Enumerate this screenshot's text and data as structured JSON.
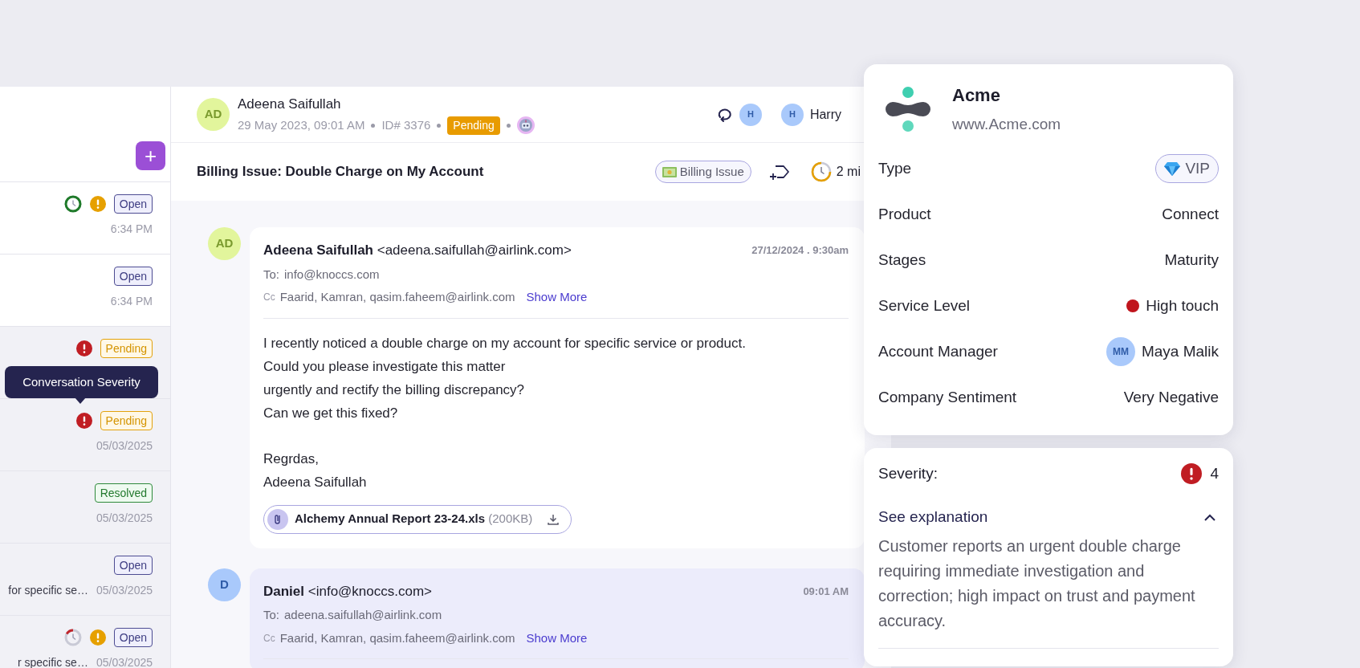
{
  "conversation_list": {
    "new_button": "+",
    "items": [
      {
        "read": false,
        "sla_overdue": false,
        "urgent": false,
        "status": "Open",
        "kind": "open",
        "time": "6:34 PM"
      },
      {
        "read": false,
        "status": "Open",
        "kind": "open",
        "time": "6:34 PM"
      },
      {
        "read": true,
        "urgent": true,
        "status": "Pending",
        "kind": "pending"
      },
      {
        "read": true,
        "urgent": true,
        "status": "Pending",
        "kind": "pending",
        "time": "05/03/2025"
      },
      {
        "read": true,
        "status": "Resolved",
        "kind": "resolved",
        "time": "05/03/2025"
      },
      {
        "read": true,
        "status": "Open",
        "kind": "open",
        "snippet": "for specific se…",
        "time": "05/03/2025"
      },
      {
        "read": true,
        "sla_overdue": true,
        "urgent": false,
        "status": "Open",
        "kind": "open",
        "snippet": "r specific se…",
        "time": "05/03/2025"
      }
    ],
    "tooltip": "Conversation Severity"
  },
  "conversation": {
    "customer": {
      "initials": "AD",
      "name": "Adeena Saifullah"
    },
    "date": "29 May 2023, 09:01 AM",
    "id": "ID# 3376",
    "status": "Pending",
    "watchers": [
      {
        "initials": "H"
      }
    ],
    "assignee": {
      "initials": "H",
      "name": "Harry"
    },
    "subject": "Billing Issue: Double Charge on My Account",
    "tag": "Billing Issue",
    "timer": "2 mi",
    "messages": [
      {
        "kind": "incoming",
        "initials": "AD",
        "sender": "Adeena Saifullah",
        "email": "<adeena.saifullah@airlink.com>",
        "time": "27/12/2024 . 9:30am",
        "to_label": "To:",
        "to": "info@knoccs.com",
        "cc_label": "Cc",
        "cc": "Faarid, Kamran, qasim.faheem@airlink.com",
        "show_more": "Show More",
        "paragraphs": [
          [
            "I recently noticed a double charge on my account for specific service or product.",
            "Could you please investigate this matter",
            "urgently and rectify the billing discrepancy?",
            "Can we get this fixed?"
          ],
          [
            "Regrdas,",
            "Adeena Saifullah"
          ]
        ],
        "attachment": {
          "name": "Alchemy Annual Report 23-24.xls",
          "size": "(200KB)"
        }
      },
      {
        "kind": "outgoing",
        "initials": "D",
        "sender": "Daniel",
        "email": "<info@knoccs.com>",
        "time": "09:01 AM",
        "to_label": "To:",
        "to": "adeena.saifullah@airlink.com",
        "cc_label": "Cc",
        "cc": "Faarid, Kamran, qasim.faheem@airlink.com",
        "show_more": "Show More"
      }
    ]
  },
  "account": {
    "name": "Acme",
    "website": "www.Acme.com",
    "fields": [
      {
        "label": "Type",
        "value": "VIP",
        "kind": "badge"
      },
      {
        "label": "Product",
        "value": "Connect",
        "kind": "text"
      },
      {
        "label": "Stages",
        "value": "Maturity",
        "kind": "text"
      },
      {
        "label": "Service Level",
        "value": "High touch",
        "kind": "dot",
        "color": "#c0141c"
      },
      {
        "label": "Account Manager",
        "value": "Maya Malik",
        "kind": "person",
        "initials": "MM"
      },
      {
        "label": "Company Sentiment",
        "value": "Very Negative",
        "kind": "text"
      }
    ]
  },
  "severity": {
    "label": "Severity:",
    "value": "4",
    "explanation": {
      "label": "See explanation",
      "expanded": true,
      "text": "Customer reports an urgent double charge requiring immediate investigation and correction; high impact on trust and payment accuracy."
    }
  }
}
